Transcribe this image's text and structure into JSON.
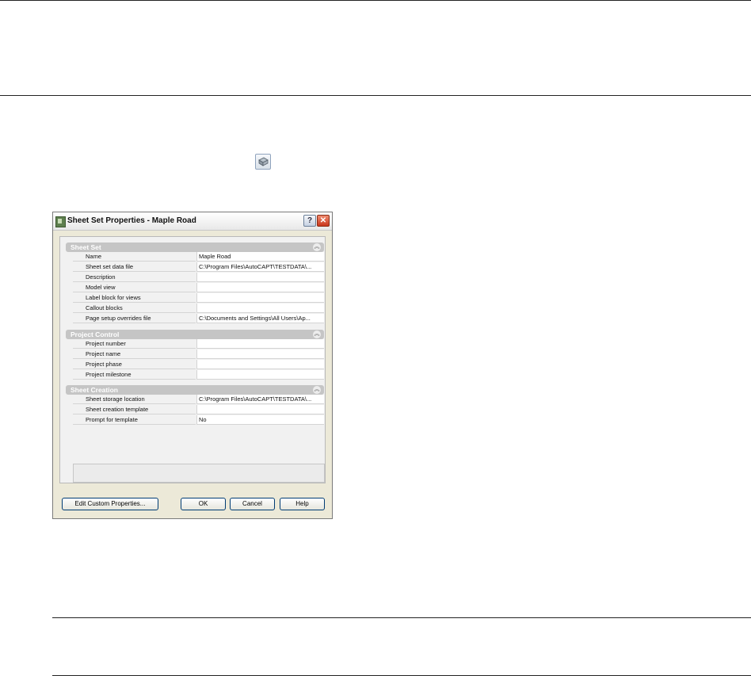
{
  "toolbar_icon": {
    "name": "sheet-set-properties-icon"
  },
  "dialog": {
    "title": "Sheet Set Properties - Maple Road",
    "help_button": "?",
    "close_button": "✕",
    "sections": [
      {
        "label": "Sheet Set",
        "rows": [
          {
            "name": "Name",
            "value": "Maple Road"
          },
          {
            "name": "Sheet set data file",
            "value": "C:\\Program Files\\AutoCAPT\\TESTDATA\\..."
          },
          {
            "name": "Description",
            "value": ""
          },
          {
            "name": "Model view",
            "value": ""
          },
          {
            "name": "Label block for views",
            "value": ""
          },
          {
            "name": "Callout blocks",
            "value": ""
          },
          {
            "name": "Page setup overrides file",
            "value": "C:\\Documents and Settings\\All Users\\Ap..."
          }
        ]
      },
      {
        "label": "Project Control",
        "rows": [
          {
            "name": "Project number",
            "value": ""
          },
          {
            "name": "Project name",
            "value": ""
          },
          {
            "name": "Project phase",
            "value": ""
          },
          {
            "name": "Project milestone",
            "value": ""
          }
        ]
      },
      {
        "label": "Sheet Creation",
        "rows": [
          {
            "name": "Sheet storage location",
            "value": "C:\\Program Files\\AutoCAPT\\TESTDATA\\..."
          },
          {
            "name": "Sheet creation template",
            "value": ""
          },
          {
            "name": "Prompt for template",
            "value": "No"
          }
        ]
      }
    ],
    "buttons": {
      "edit_custom": "Edit Custom Properties...",
      "ok": "OK",
      "cancel": "Cancel",
      "help": "Help"
    }
  }
}
